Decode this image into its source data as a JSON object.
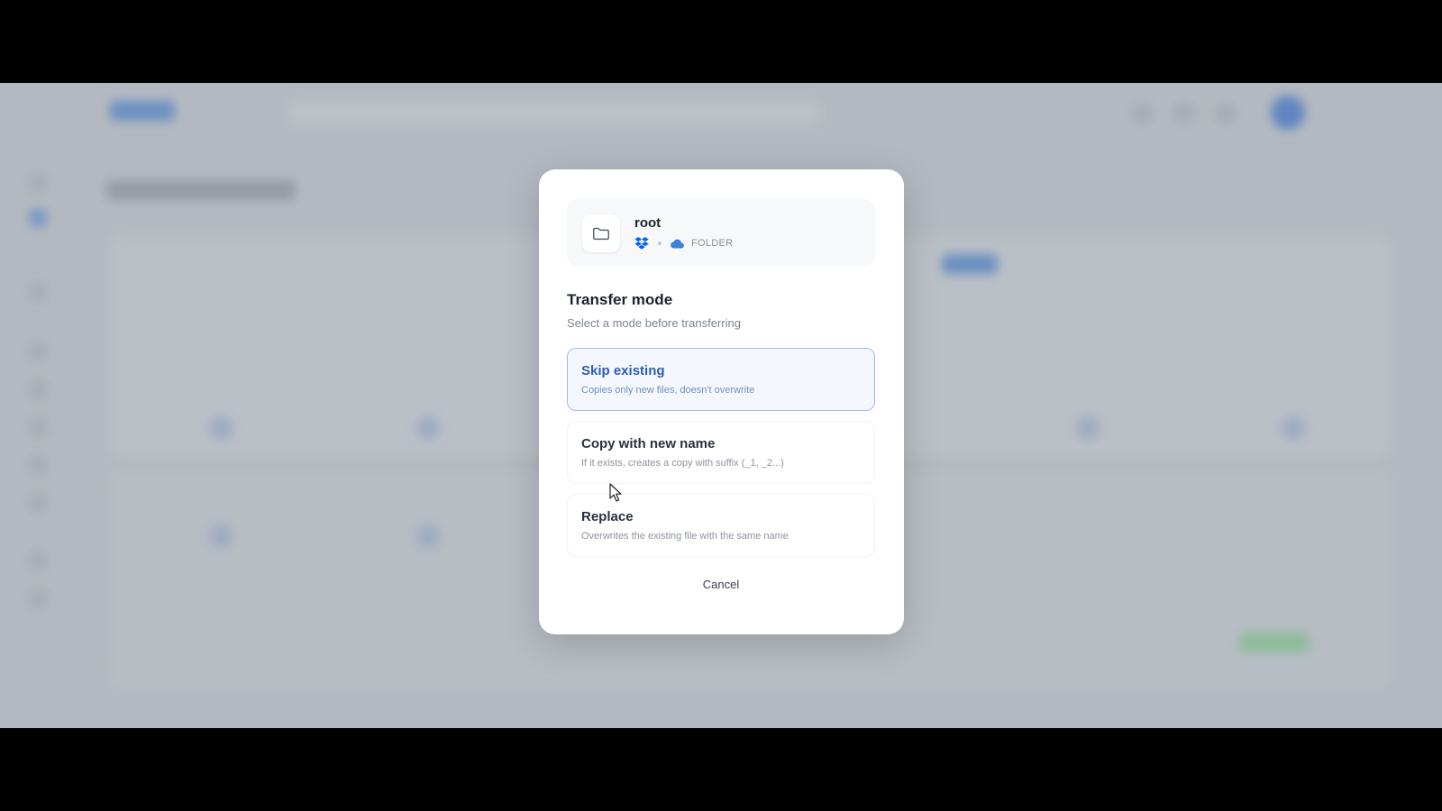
{
  "dialog": {
    "file": {
      "name": "root",
      "type_label": "FOLDER",
      "icon": "folder-icon",
      "source_icon": "dropbox-icon",
      "destination_icon": "cloud-icon"
    },
    "title": "Transfer mode",
    "subtitle": "Select a mode before transferring",
    "options": [
      {
        "title": "Skip existing",
        "description": "Copies only new files, doesn't overwrite",
        "selected": true
      },
      {
        "title": "Copy with new name",
        "description": "If it exists, creates a copy with suffix (_1, _2...)",
        "selected": false
      },
      {
        "title": "Replace",
        "description": "Overwrites the existing file with the same name",
        "selected": false
      }
    ],
    "cancel_label": "Cancel"
  },
  "colors": {
    "accent": "#2f5db3",
    "selected_border": "#9cbbe8",
    "selected_bg": "#f4f8fe",
    "dropbox": "#0061fe",
    "cloud": "#3b82d6"
  }
}
